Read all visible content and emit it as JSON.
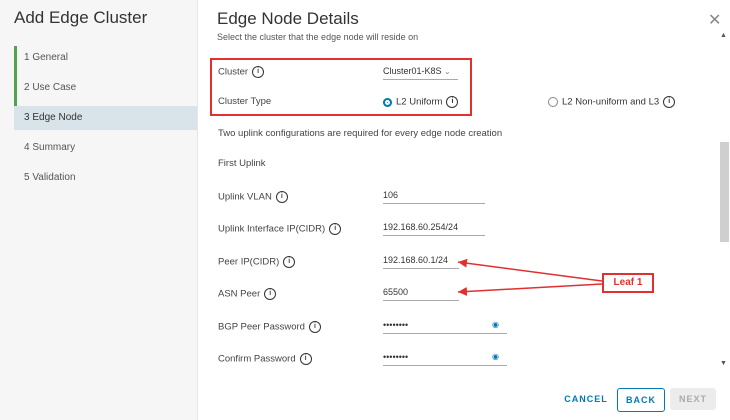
{
  "wizard": {
    "title": "Add Edge Cluster",
    "steps": [
      {
        "label": "1 General"
      },
      {
        "label": "2 Use Case"
      },
      {
        "label": "3 Edge Node"
      },
      {
        "label": "4 Summary"
      },
      {
        "label": "5 Validation"
      }
    ]
  },
  "panel": {
    "title": "Edge Node Details",
    "subtitle": "Select the cluster that the edge node will reside on",
    "close_glyph": "✕"
  },
  "form": {
    "cluster_label": "Cluster",
    "cluster_value": "Cluster01-K8S",
    "cluster_type_label": "Cluster Type",
    "cluster_type_options": [
      "L2 Uniform",
      "L2 Non-uniform and L3"
    ],
    "cluster_type_selected": "L2 Uniform",
    "uplink_note": "Two uplink configurations are required for every edge node creation",
    "first_uplink_heading": "First Uplink",
    "uplink_vlan_label": "Uplink VLAN",
    "uplink_vlan_value": "106",
    "uplink_ip_label": "Uplink Interface IP(CIDR)",
    "uplink_ip_value": "192.168.60.254/24",
    "peer_ip_label": "Peer IP(CIDR)",
    "peer_ip_value": "192.168.60.1/24",
    "asn_peer_label": "ASN Peer",
    "asn_peer_value": "65500",
    "bgp_pw_label": "BGP Peer Password",
    "bgp_pw_value": "••••••••",
    "confirm_pw_label": "Confirm Password",
    "confirm_pw_value": "••••••••"
  },
  "annotation": {
    "label": "Leaf 1",
    "color": "#e03030"
  },
  "buttons": {
    "cancel": "CANCEL",
    "back": "BACK",
    "next": "NEXT"
  },
  "icons": {
    "info": "info-icon",
    "eye": "eye-icon",
    "chevron": "chevron-down-icon"
  },
  "colors": {
    "accent": "#0079b8",
    "done": "#51a351",
    "highlight": "#e03030"
  }
}
